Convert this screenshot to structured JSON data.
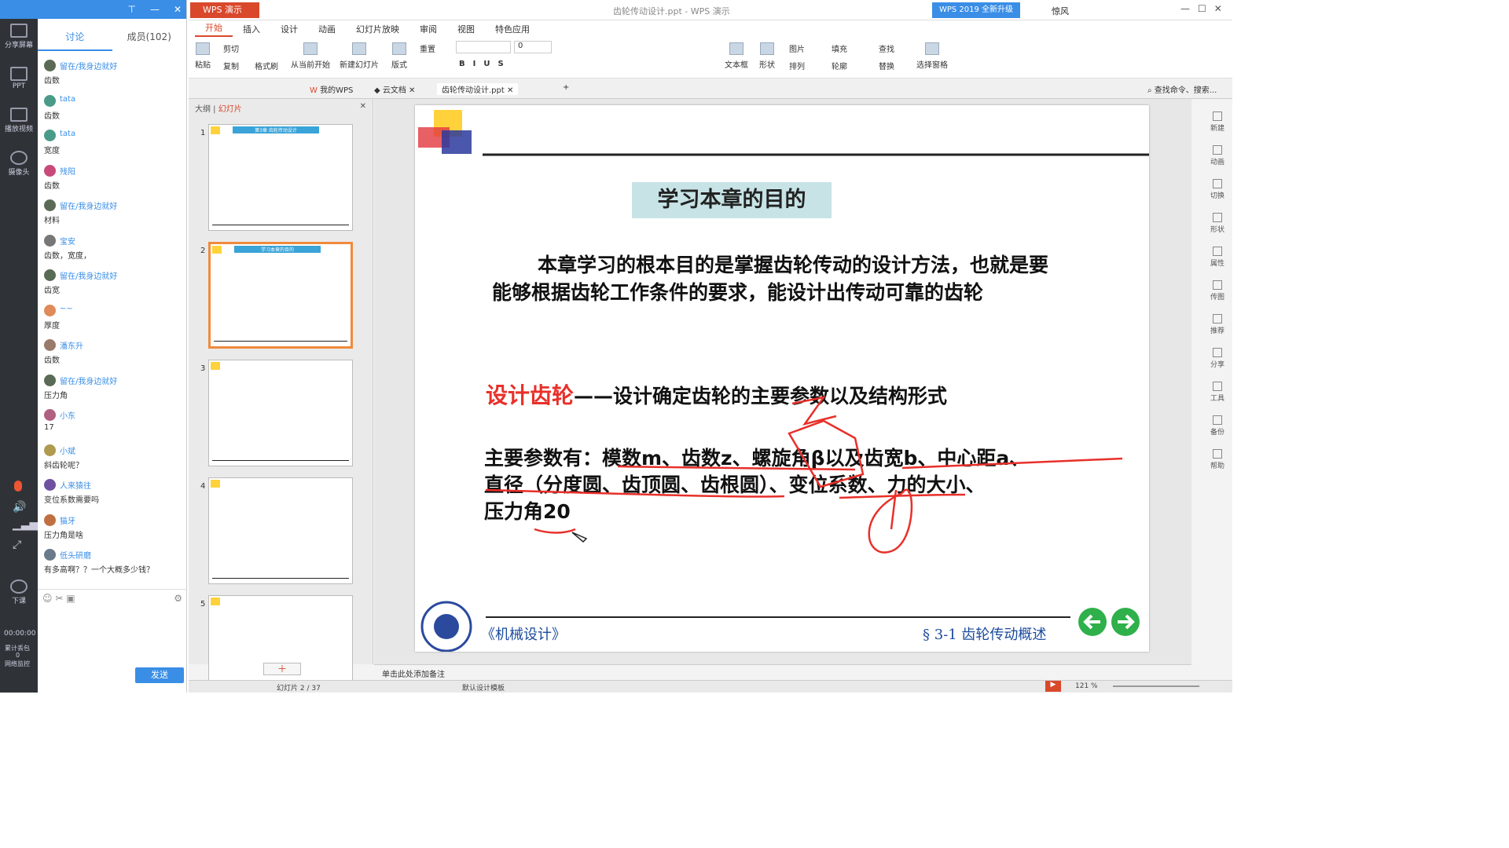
{
  "left_strip": {
    "share": "分享屏幕",
    "ppt": "PPT",
    "video": "播放视频",
    "camera": "摄像头",
    "end": "下课",
    "time": "00:00:00",
    "dropped": "累计丢包",
    "dropped_val": "0",
    "network": "网络监控"
  },
  "chat": {
    "tab_discuss": "讨论",
    "tab_members": "成员(102)",
    "send": "发送",
    "messages": [
      {
        "name": "留在/我身边就好",
        "text": "齿数"
      },
      {
        "name": "tata",
        "text": "齿数"
      },
      {
        "name": "tata",
        "text": "宽度"
      },
      {
        "name": "残阳",
        "text": "齿数"
      },
      {
        "name": "留在/我身边就好",
        "text": "材料"
      },
      {
        "name": "宝安",
        "text": "齿数，宽度，"
      },
      {
        "name": "留在/我身边就好",
        "text": "齿宽"
      },
      {
        "name": "~~",
        "text": "厚度"
      },
      {
        "name": "潘东升",
        "text": "齿数"
      },
      {
        "name": "留在/我身边就好",
        "text": "压力角"
      },
      {
        "name": "小东",
        "text": "17"
      },
      {
        "name": "小斌",
        "text": "斜齿轮呢？"
      },
      {
        "name": "人来猿往",
        "text": "变位系数需要吗"
      },
      {
        "name": "猫牙",
        "text": "压力角是啥"
      },
      {
        "name": "低头研磨",
        "text": "有多高啊？？一个大概多少钱？"
      }
    ]
  },
  "wps": {
    "app": "WPS 演示",
    "doc_title": "齿轮传动设计.ppt - WPS 演示",
    "upgrade": "WPS 2019 全新升级",
    "user": "惊风",
    "menus": [
      "开始",
      "插入",
      "设计",
      "动画",
      "幻灯片放映",
      "审阅",
      "视图",
      "特色应用"
    ],
    "ribbon": {
      "paste": "粘贴",
      "cut": "剪切",
      "copy": "复制",
      "format_painter": "格式刷",
      "from_start": "从当前开始",
      "new_slide": "新建幻灯片",
      "layout": "版式",
      "reset": "重置",
      "font_size": "0",
      "textbox": "文本框",
      "shapes": "形状",
      "picture": "图片",
      "arrange": "排列",
      "fill": "填充",
      "outline": "轮廓",
      "find": "查找",
      "replace": "替换",
      "select_pane": "选择窗格"
    },
    "doc_tabs": {
      "mywps": "我的WPS",
      "cloud": "云文档",
      "file": "齿轮传动设计.ppt",
      "search": "查找命令、搜索..."
    },
    "panel": {
      "outline": "大纲",
      "slides": "幻灯片"
    },
    "notes": "单击此处添加备注",
    "status": {
      "slide": "幻灯片 2 / 37",
      "template": "默认设计模板",
      "zoom": "121 %"
    },
    "side": [
      "新建",
      "动画",
      "切换",
      "形状",
      "属性",
      "传图",
      "推荐",
      "分享",
      "工具",
      "备份",
      "帮助"
    ]
  },
  "slide": {
    "title": "学习本章的目的",
    "para1": "本章学习的根本目的是掌握齿轮传动的设计方法，也就是要能够根据齿轮工作条件的要求，能设计出传动可靠的齿轮",
    "design_label": "设计齿轮",
    "design_text": "——设计确定齿轮的主要参数以及结构形式",
    "params_line1": "主要参数有：模数m、齿数z、螺旋角β以及齿宽b、中心距a、",
    "params_line2": "直径（分度圆、齿顶圆、齿根圆）、变位系数、力的大小、",
    "params_line3": "压力角20",
    "footer_left": "《机械设计》",
    "footer_right": "§ 3-1  齿轮传动概述"
  },
  "thumbs": [
    {
      "num": "1",
      "title": "第3章  齿轮传动设计"
    },
    {
      "num": "2",
      "title": "学习本章的目的"
    },
    {
      "num": "3",
      "title": ""
    },
    {
      "num": "4",
      "title": ""
    },
    {
      "num": "5",
      "title": ""
    }
  ]
}
